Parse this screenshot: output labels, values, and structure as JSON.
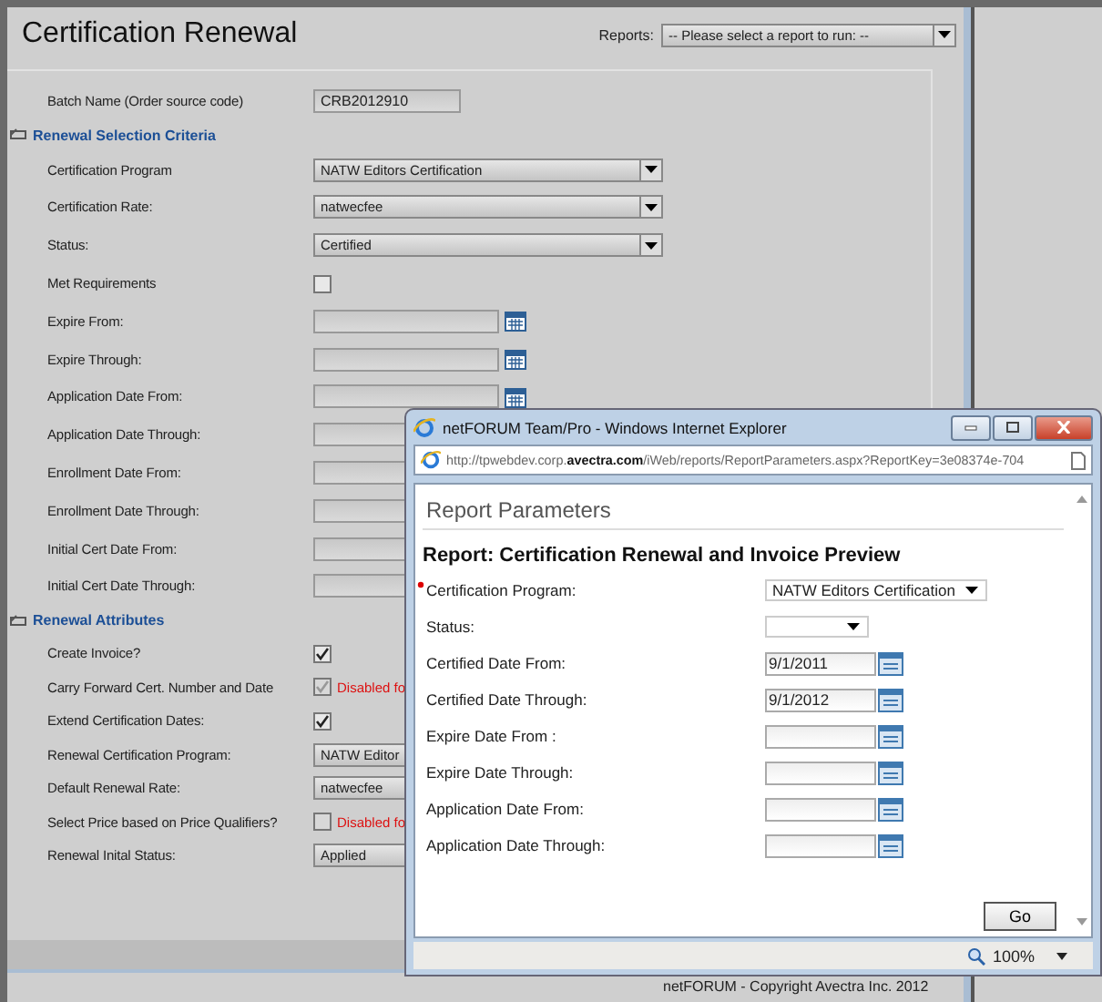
{
  "page": {
    "title": "Certification Renewal",
    "reports_label": "Reports:",
    "reports_select": "-- Please select a report to run: --"
  },
  "batch": {
    "label": "Batch Name (Order source code)",
    "value": "CRB2012910"
  },
  "sections": [
    {
      "title": "Renewal Selection Criteria",
      "rows": [
        {
          "kind": "select",
          "label": "Certification Program",
          "value": "NATW Editors Certification"
        },
        {
          "kind": "select",
          "label": "Certification Rate:",
          "value": "natwecfee"
        },
        {
          "kind": "select",
          "label": "Status:",
          "value": "Certified"
        },
        {
          "kind": "checkbox",
          "label": "Met Requirements",
          "checked": false,
          "disabled": false
        },
        {
          "kind": "date",
          "label": "Expire From:"
        },
        {
          "kind": "date",
          "label": "Expire Through:"
        },
        {
          "kind": "date",
          "label": "Application Date From:"
        },
        {
          "kind": "date",
          "label": "Application Date Through:"
        },
        {
          "kind": "date",
          "label": "Enrollment Date From:"
        },
        {
          "kind": "date",
          "label": "Enrollment Date Through:"
        },
        {
          "kind": "date",
          "label": "Initial Cert Date From:"
        },
        {
          "kind": "date",
          "label": "Initial Cert Date Through:"
        }
      ]
    },
    {
      "title": "Renewal Attributes",
      "rows": [
        {
          "kind": "checkbox",
          "label": "Create Invoice?",
          "checked": true,
          "disabled": false
        },
        {
          "kind": "checkbox",
          "label": "Carry Forward Cert. Number and Date",
          "checked": true,
          "disabled": true,
          "note": "Disabled fo"
        },
        {
          "kind": "checkbox",
          "label": "Extend Certification Dates:",
          "checked": true,
          "disabled": false
        },
        {
          "kind": "select",
          "label": "Renewal Certification Program:",
          "value": "NATW Editor"
        },
        {
          "kind": "select",
          "label": "Default Renewal Rate:",
          "value": "natwecfee"
        },
        {
          "kind": "checkbox",
          "label": "Select Price based on Price Qualifiers?",
          "checked": false,
          "disabled": true,
          "note": "Disabled fo"
        },
        {
          "kind": "select",
          "label": "Renewal Inital Status:",
          "value": "Applied"
        }
      ]
    }
  ],
  "footer": "netFORUM - Copyright Avectra Inc. 2012",
  "popup": {
    "title": "netFORUM Team/Pro - Windows Internet Explorer",
    "url": "http://tpwebdev.corp.**avectra.com**/iWeb/reports/ReportParameters.aspx?ReportKey=3e08374e-704",
    "heading": "Report Parameters",
    "report_title": "Report: Certification Renewal and Invoice Preview",
    "fields": [
      {
        "kind": "select",
        "label": "Certification Program:",
        "value": "NATW Editors Certification",
        "required": true
      },
      {
        "kind": "select",
        "label": "Status:",
        "required": false
      },
      {
        "kind": "date",
        "label": "Certified Date From:",
        "value": "9/1/2011",
        "required": false
      },
      {
        "kind": "date",
        "label": "Certified Date Through:",
        "value": "9/1/2012",
        "required": false
      },
      {
        "kind": "date",
        "label": "Expire Date From :",
        "required": false
      },
      {
        "kind": "date",
        "label": "Expire Date Through:",
        "required": false
      },
      {
        "kind": "date",
        "label": "Application Date From:",
        "required": false
      },
      {
        "kind": "date",
        "label": "Application Date Through:",
        "required": false
      }
    ],
    "button": "Go",
    "zoom": "100%"
  }
}
